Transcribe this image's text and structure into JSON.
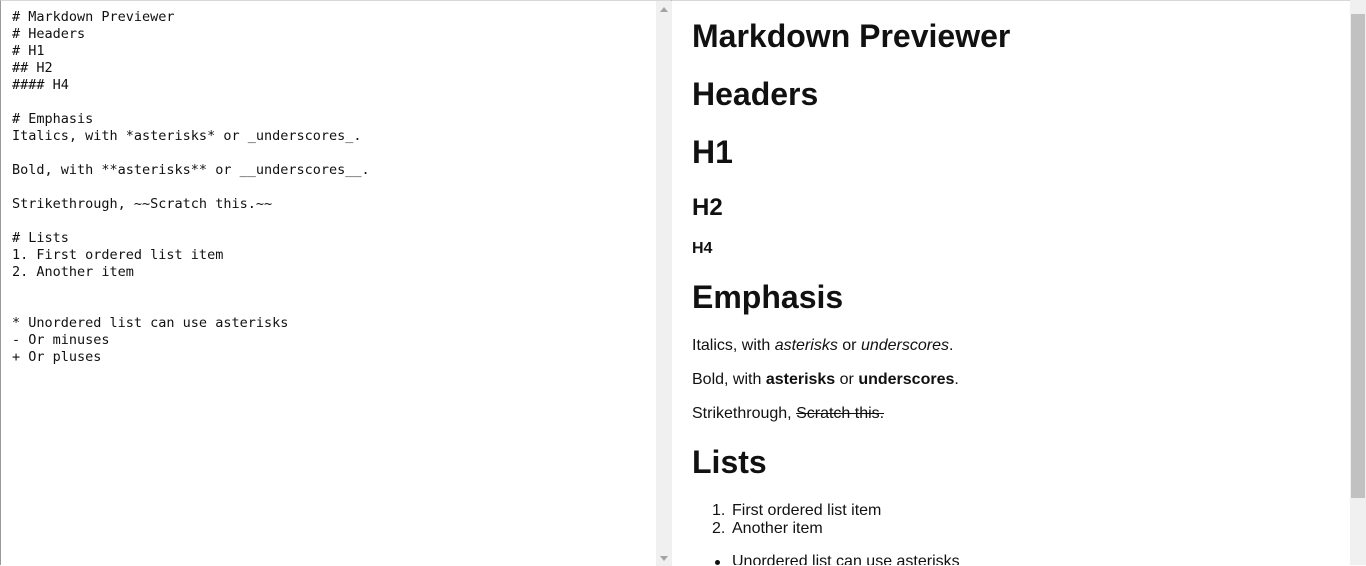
{
  "editor": {
    "text": "# Markdown Previewer\n# Headers\n# H1\n## H2\n#### H4\n\n# Emphasis\nItalics, with *asterisks* or _underscores_.\n\nBold, with **asterisks** or __underscores__.\n\nStrikethrough, ~~Scratch this.~~\n\n# Lists\n1. First ordered list item\n2. Another item\n\n\n* Unordered list can use asterisks\n- Or minuses\n+ Or pluses"
  },
  "preview": {
    "title": "Markdown Previewer",
    "headers": "Headers",
    "h1": "H1",
    "h2": "H2",
    "h4": "H4",
    "emphasis_heading": "Emphasis",
    "italics": {
      "prefix": "Italics, with ",
      "a": "asterisks",
      "mid": " or ",
      "b": "underscores",
      "end": "."
    },
    "bold": {
      "prefix": "Bold, with ",
      "a": "asterisks",
      "mid": " or ",
      "b": "underscores",
      "end": "."
    },
    "strike": {
      "prefix": "Strikethrough, ",
      "struck": "Scratch this."
    },
    "lists_heading": "Lists",
    "ordered": [
      {
        "num": "1.",
        "text": "First ordered list item"
      },
      {
        "num": "2.",
        "text": "Another item"
      }
    ],
    "unordered": [
      "Unordered list can use asterisks"
    ]
  }
}
